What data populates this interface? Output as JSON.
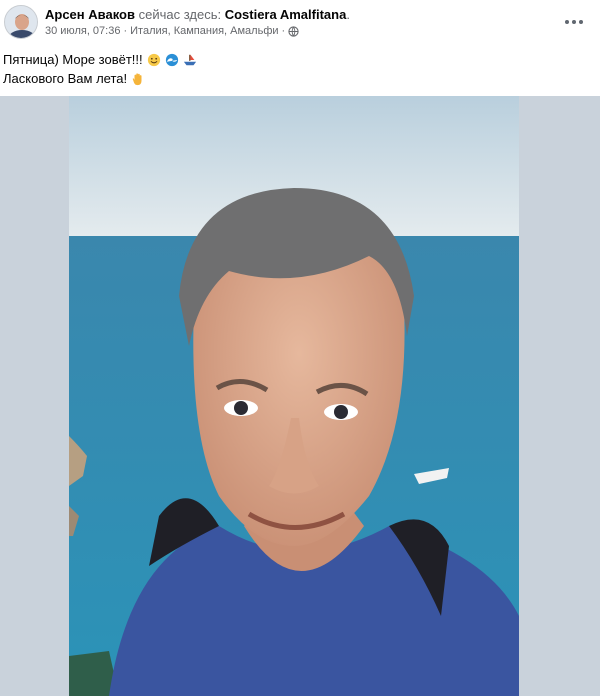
{
  "post": {
    "author": "Арсен Аваков",
    "action": "сейчас здесь:",
    "place": "Costiera Amalfitana",
    "place_suffix": ".",
    "date": "30 июля, 07:36",
    "separator": "·",
    "location": "Италия, Кампания, Амальфи",
    "privacy_icon": "globe-icon",
    "menu_icon": "more-options-icon",
    "text_line_1": "Пятница) Море зовёт!!!",
    "text_line_2": "Ласкового Вам лета!",
    "emojis_line_1": [
      "smiling-face-emoji",
      "wave-emoji",
      "boat-emoji"
    ],
    "emojis_line_2": [
      "raised-hand-emoji"
    ]
  },
  "colors": {
    "text": "#050505",
    "secondary_text": "#65676b",
    "media_background": "#c9d2db",
    "sky": "#dde6ec",
    "sea": "#2f8cb7",
    "shirt": "#3a55a0"
  }
}
